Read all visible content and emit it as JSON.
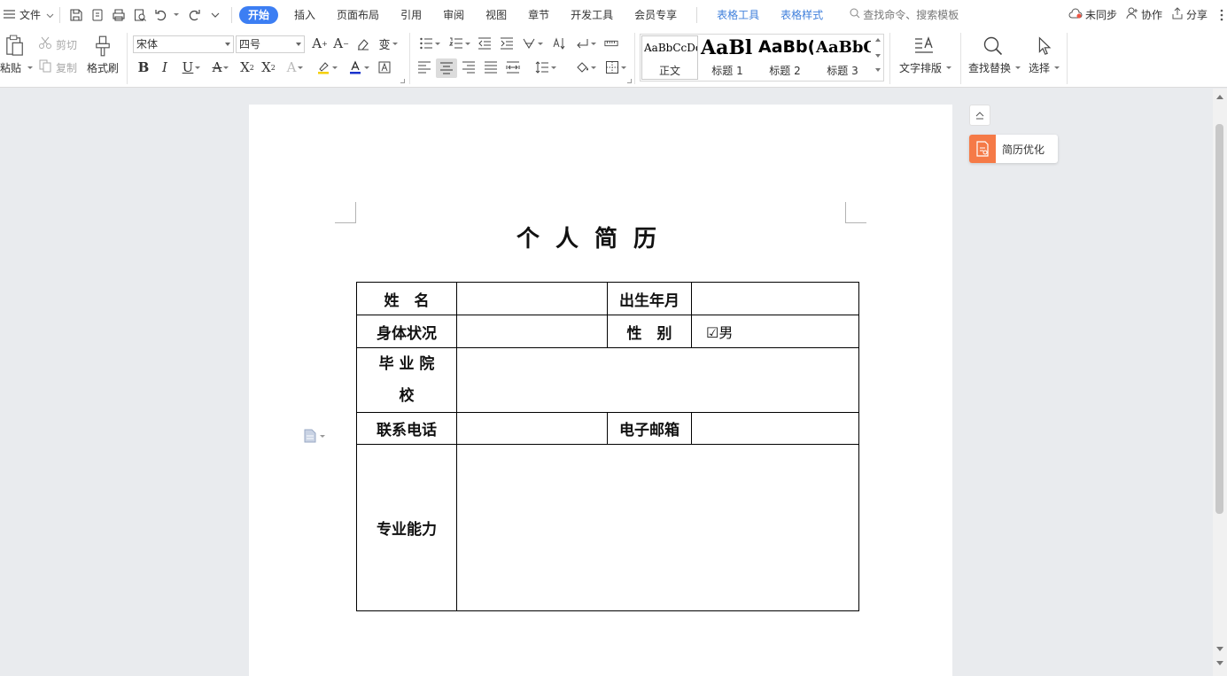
{
  "menubar": {
    "file_label": "文件",
    "tabs": [
      {
        "label": "开始",
        "active": true
      },
      {
        "label": "插入"
      },
      {
        "label": "页面布局"
      },
      {
        "label": "引用"
      },
      {
        "label": "审阅"
      },
      {
        "label": "视图"
      },
      {
        "label": "章节"
      },
      {
        "label": "开发工具"
      },
      {
        "label": "会员专享"
      }
    ],
    "context_tabs": [
      {
        "label": "表格工具"
      },
      {
        "label": "表格样式"
      }
    ],
    "search_placeholder": "查找命令、搜索模板",
    "sync_label": "未同步",
    "collab_label": "协作",
    "share_label": "分享"
  },
  "ribbon": {
    "paste_label": "粘贴",
    "cut_label": "剪切",
    "copy_label": "复制",
    "format_painter_label": "格式刷",
    "font_name": "宋体",
    "font_size": "四号",
    "styles": [
      {
        "sample": "AaBbCcDd",
        "name": "正文"
      },
      {
        "sample": "AaBl",
        "name": "标题 1"
      },
      {
        "sample": "AaBb(",
        "name": "标题 2"
      },
      {
        "sample": "AaBbC",
        "name": "标题 3"
      }
    ],
    "text_layout_label": "文字排版",
    "find_replace_label": "查找替换",
    "select_label": "选择",
    "font_color": "#1a33cc",
    "highlight_color": "#f5d000"
  },
  "document": {
    "title": "个人简历",
    "table": {
      "name_label": "姓　名",
      "birth_label": "出生年月",
      "health_label": "身体状况",
      "gender_label": "性　别",
      "gender_value": "☑男",
      "school_label_line1": "毕 业 院",
      "school_label_line2": "校",
      "phone_label": "联系电话",
      "email_label": "电子邮箱",
      "skills_label": "专业能力"
    }
  },
  "side": {
    "resume_optimize_label": "简历优化"
  },
  "colors": {
    "accent": "#3c7ef3",
    "context_tab": "#3f7fdb",
    "resume_optimize": "#f57a47"
  }
}
